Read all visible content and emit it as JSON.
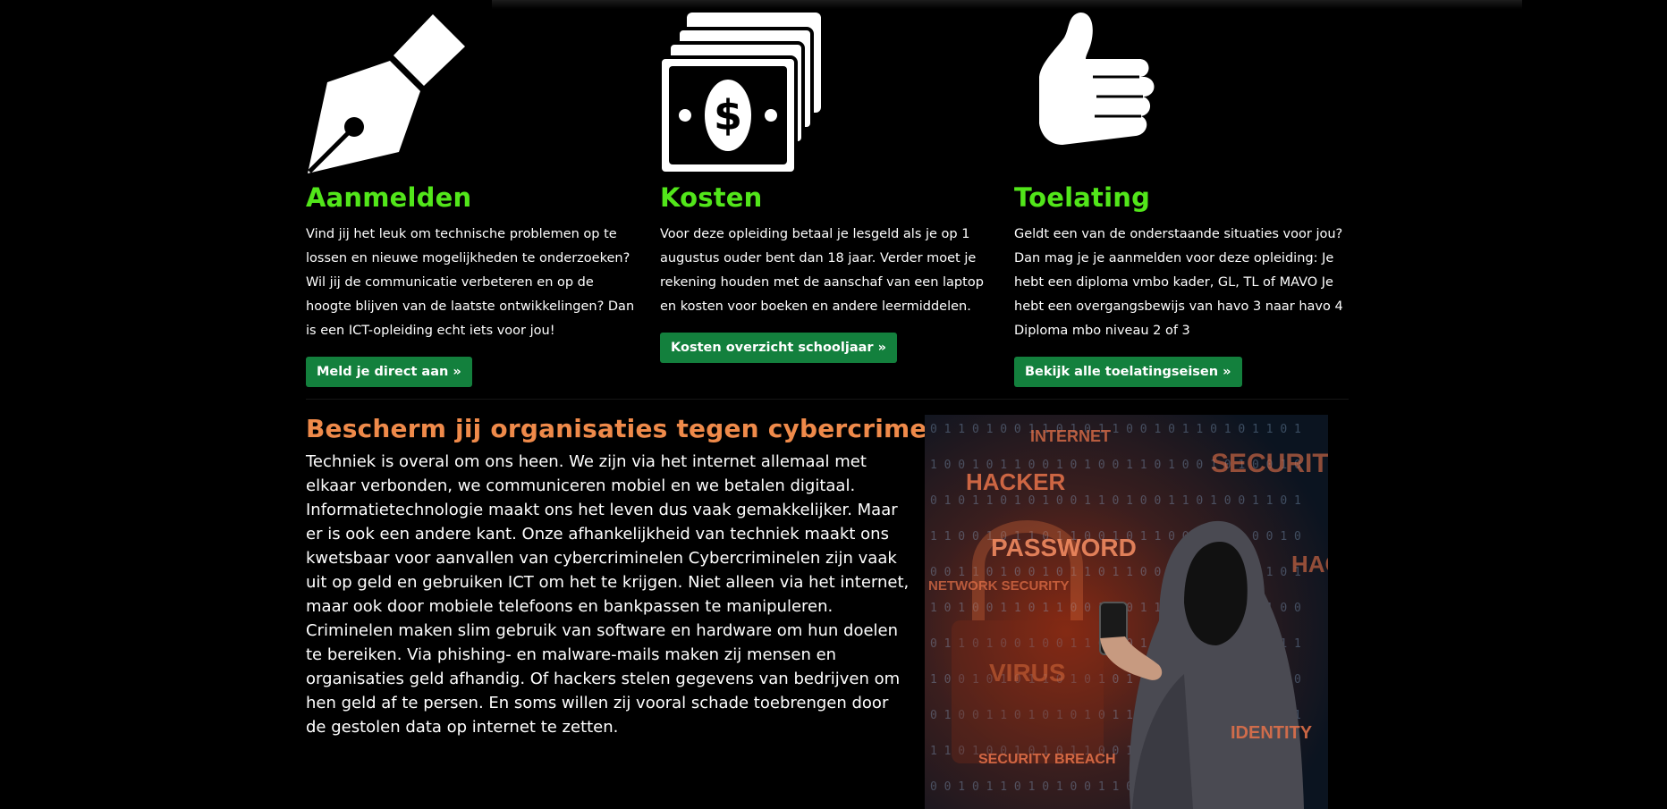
{
  "columns": [
    {
      "icon": "fountain-pen-icon",
      "title": "Aanmelden",
      "text": "Vind jij het leuk om technische problemen op te lossen en nieuwe mogelijkheden te onderzoeken? Wil jij de communicatie verbeteren en op de hoogte blijven van de laatste ontwikkelingen? Dan is een ICT-opleiding echt iets voor jou!",
      "button": "Meld je direct aan »"
    },
    {
      "icon": "money-bills-icon",
      "title": "Kosten",
      "text": "Voor deze opleiding betaal je lesgeld als je op 1 augustus ouder bent dan 18 jaar. Verder moet je rekening houden met de aanschaf van een laptop en kosten voor boeken en andere leermiddelen.",
      "button": "Kosten overzicht schooljaar »"
    },
    {
      "icon": "thumbs-up-icon",
      "title": "Toelating",
      "text": "Geldt een van de onderstaande situaties voor jou? Dan mag je je aanmelden voor deze opleiding: Je hebt een diploma vmbo kader, GL, TL of MAVO Je hebt een overgangsbewijs van havo 3 naar havo 4 Diploma mbo niveau 2 of 3",
      "button": "Bekijk alle toelatingseisen »"
    }
  ],
  "cyber": {
    "title": "Bescherm jij organisaties tegen cybercrime?",
    "text": "Techniek is overal om ons heen. We zijn via het internet allemaal met elkaar verbonden, we communiceren mobiel en we betalen digitaal. Informatietechnologie maakt ons het leven dus vaak gemakkelijker. Maar er is ook een andere kant. Onze afhankelijkheid van techniek maakt ons kwetsbaar voor aanvallen van cybercriminelen Cybercriminelen zijn vaak uit op geld en gebruiken ICT om het te krijgen. Niet alleen via het internet, maar ook door mobiele telefoons en bankpassen te manipuleren. Criminelen maken slim gebruik van software en hardware om hun doelen te bereiken. Via phishing- en malware-mails maken zij mensen en organisaties geld afhandig. Of hackers stelen gegevens van bedrijven om hen geld af te persen. En soms willen zij vooral schade toebrengen door de gestolen data op internet te zetten.",
    "image_words": [
      "INTERNET",
      "HACKER",
      "SECURITY",
      "PASSWORD",
      "NETWORK SECURITY",
      "HAC",
      "VIRUS",
      "IDENTITY",
      "SECURITY BREACH"
    ]
  },
  "colors": {
    "heading_green": "#52e61a",
    "heading_orange": "#ef8a4a",
    "button_green": "#13803d",
    "background": "#000000"
  }
}
